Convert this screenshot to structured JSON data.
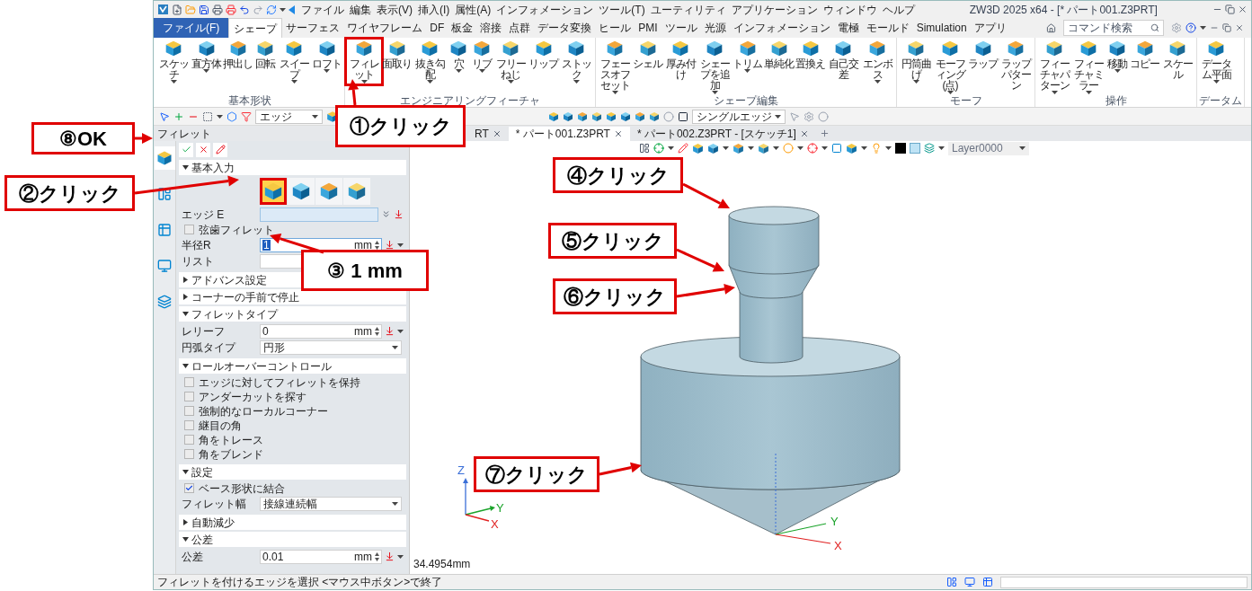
{
  "menu": [
    "ファイル",
    "編集",
    "表示(V)",
    "挿入(I)",
    "属性(A)",
    "インフォメーション",
    "ツール(T)",
    "ユーティリティ",
    "アプリケーション",
    "ウィンドウ",
    "ヘルプ"
  ],
  "window": {
    "title": "ZW3D 2025 x64 - [* パート001.Z3PRT]"
  },
  "ribbon_tabs": [
    {
      "label": "ファイル(F)",
      "kind": "file",
      "selected": false
    },
    {
      "label": "シェープ",
      "kind": "tab",
      "selected": true
    },
    {
      "label": "サーフェス",
      "kind": "tab",
      "selected": false
    },
    {
      "label": "ワイヤフレーム",
      "kind": "tab",
      "selected": false
    },
    {
      "label": "DF",
      "kind": "tab",
      "selected": false
    },
    {
      "label": "板金",
      "kind": "tab",
      "selected": false
    },
    {
      "label": "溶接",
      "kind": "tab",
      "selected": false
    },
    {
      "label": "点群",
      "kind": "tab",
      "selected": false
    },
    {
      "label": "データ変換",
      "kind": "tab",
      "selected": false
    },
    {
      "label": "ヒール",
      "kind": "tab",
      "selected": false
    },
    {
      "label": "PMI",
      "kind": "tab",
      "selected": false
    },
    {
      "label": "ツール",
      "kind": "tab",
      "selected": false
    },
    {
      "label": "光源",
      "kind": "tab",
      "selected": false
    },
    {
      "label": "インフォメーション",
      "kind": "tab",
      "selected": false
    },
    {
      "label": "電極",
      "kind": "tab",
      "selected": false
    },
    {
      "label": "モールド",
      "kind": "tab",
      "selected": false
    },
    {
      "label": "Simulation",
      "kind": "tab",
      "selected": false
    },
    {
      "label": "アプリ",
      "kind": "tab",
      "selected": false
    }
  ],
  "command_search": {
    "placeholder": "コマンド検索"
  },
  "ribbon_groups": [
    {
      "title": "基本形状",
      "commands": [
        {
          "label": "スケッチ",
          "dropdown": true,
          "highlighted": false
        },
        {
          "label": "直方体",
          "dropdown": true,
          "highlighted": false
        },
        {
          "label": "押出し",
          "dropdown": false,
          "highlighted": false
        },
        {
          "label": "回転",
          "dropdown": false,
          "highlighted": false
        },
        {
          "label": "スイープ",
          "dropdown": true,
          "highlighted": false
        },
        {
          "label": "ロフト",
          "dropdown": true,
          "highlighted": false
        }
      ]
    },
    {
      "title": "エンジニアリングフィーチャ",
      "commands": [
        {
          "label": "フィレット",
          "dropdown": true,
          "highlighted": true
        },
        {
          "label": "面取り",
          "dropdown": false,
          "highlighted": false
        },
        {
          "label": "抜き勾配",
          "dropdown": true,
          "highlighted": false
        },
        {
          "label": "穴",
          "dropdown": true,
          "highlighted": false
        },
        {
          "label": "リブ",
          "dropdown": true,
          "highlighted": false
        },
        {
          "label": "フリーねじ",
          "dropdown": true,
          "highlighted": false
        },
        {
          "label": "リップ",
          "dropdown": false,
          "highlighted": false
        },
        {
          "label": "ストック",
          "dropdown": true,
          "highlighted": false
        }
      ]
    },
    {
      "title": "シェープ編集",
      "commands": [
        {
          "label": "フェースオフセット",
          "dropdown": true,
          "highlighted": false
        },
        {
          "label": "シェル",
          "dropdown": false,
          "highlighted": false
        },
        {
          "label": "厚み付け",
          "dropdown": false,
          "highlighted": false
        },
        {
          "label": "シェープを追加",
          "dropdown": true,
          "highlighted": false
        },
        {
          "label": "トリム",
          "dropdown": true,
          "highlighted": false
        },
        {
          "label": "単純化",
          "dropdown": false,
          "highlighted": false
        },
        {
          "label": "置換え",
          "dropdown": false,
          "highlighted": false
        },
        {
          "label": "自己交差",
          "dropdown": false,
          "highlighted": false
        },
        {
          "label": "エンボス",
          "dropdown": true,
          "highlighted": false
        }
      ]
    },
    {
      "title": "モーフ",
      "commands": [
        {
          "label": "円筒曲げ",
          "dropdown": true,
          "highlighted": false
        },
        {
          "label": "モーフィング(点)",
          "dropdown": true,
          "highlighted": false
        },
        {
          "label": "ラップ",
          "dropdown": false,
          "highlighted": false
        },
        {
          "label": "ラップパターン",
          "dropdown": false,
          "highlighted": false
        }
      ]
    },
    {
      "title": "操作",
      "commands": [
        {
          "label": "フィーチャパターン",
          "dropdown": true,
          "highlighted": false
        },
        {
          "label": "フィーチャミラー",
          "dropdown": true,
          "highlighted": false
        },
        {
          "label": "移動",
          "dropdown": true,
          "highlighted": false
        },
        {
          "label": "コピー",
          "dropdown": false,
          "highlighted": false
        },
        {
          "label": "スケール",
          "dropdown": false,
          "highlighted": false
        }
      ]
    },
    {
      "title": "データム",
      "commands": [
        {
          "label": "データム平面",
          "dropdown": true,
          "highlighted": false
        }
      ]
    }
  ],
  "toolbar": {
    "filter": "エッジ",
    "pick_mode": "シングルエッジ"
  },
  "document_tabs": [
    {
      "label": "RT",
      "selected": false
    },
    {
      "label": "* パート001.Z3PRT",
      "selected": true
    },
    {
      "label": "* パート002.Z3PRT - [スケッチ1]",
      "selected": false
    }
  ],
  "panel": {
    "title": "フィレット",
    "side_tabs": [
      {
        "selected": true
      },
      {
        "selected": false
      },
      {
        "selected": false
      },
      {
        "selected": false
      },
      {
        "selected": false
      }
    ],
    "sections": [
      {
        "title": "基本入力",
        "expanded": true,
        "rows": [
          {
            "kind": "type_buttons",
            "options": [
              {
                "selected": true
              },
              {
                "selected": false
              },
              {
                "selected": false
              },
              {
                "selected": false
              }
            ]
          },
          {
            "kind": "pick",
            "label": "エッジ E"
          },
          {
            "kind": "checkbox",
            "label": "弦歯フィレット",
            "checked": false
          },
          {
            "kind": "number",
            "label": "半径R",
            "value": "1",
            "unit": "mm",
            "highlighted": true
          },
          {
            "kind": "list",
            "label": "リスト"
          }
        ]
      },
      {
        "title": "アドバンス設定",
        "expanded": false
      },
      {
        "title": "コーナーの手前で停止",
        "expanded": false
      },
      {
        "title": "フィレットタイプ",
        "expanded": true,
        "rows": [
          {
            "kind": "number",
            "label": "レリーフ",
            "value": "0",
            "unit": "mm",
            "highlighted": false
          },
          {
            "kind": "select",
            "label": "円弧タイプ",
            "value": "円形"
          }
        ]
      },
      {
        "title": "ロールオーバーコントロール",
        "expanded": true,
        "rows": [
          {
            "kind": "checkbox",
            "label": "エッジに対してフィレットを保持",
            "checked": false
          },
          {
            "kind": "checkbox",
            "label": "アンダーカットを探す",
            "checked": false
          },
          {
            "kind": "checkbox",
            "label": "強制的なローカルコーナー",
            "checked": false
          },
          {
            "kind": "checkbox",
            "label": "継目の角",
            "checked": false
          },
          {
            "kind": "checkbox",
            "label": "角をトレース",
            "checked": false
          },
          {
            "kind": "checkbox",
            "label": "角をブレンド",
            "checked": false
          }
        ]
      },
      {
        "title": "設定",
        "expanded": true,
        "rows": [
          {
            "kind": "checkbox",
            "label": "ベース形状に結合",
            "checked": true
          },
          {
            "kind": "select",
            "label": "フィレット幅",
            "value": "接線連続幅"
          }
        ]
      },
      {
        "title": "自動減少",
        "expanded": false
      },
      {
        "title": "公差",
        "expanded": true,
        "rows": [
          {
            "kind": "number",
            "label": "公差",
            "value": "0.01",
            "unit": "mm",
            "highlighted": false
          }
        ]
      }
    ]
  },
  "viewport": {
    "layer": "Layer0000",
    "measurement": "34.4954mm",
    "origin_axis_labels": [
      "Z",
      "Y",
      "X"
    ],
    "model_axis_labels": [
      "Y",
      "X"
    ]
  },
  "status_bar": {
    "message": "フィレットを付けるエッジを選択 <マウス中ボタン>で終了"
  },
  "callouts": [
    "①クリック",
    "⑧OK",
    "②クリック",
    "③ 1 mm",
    "④クリック",
    "⑤クリック",
    "⑥クリック",
    "⑦クリック"
  ]
}
